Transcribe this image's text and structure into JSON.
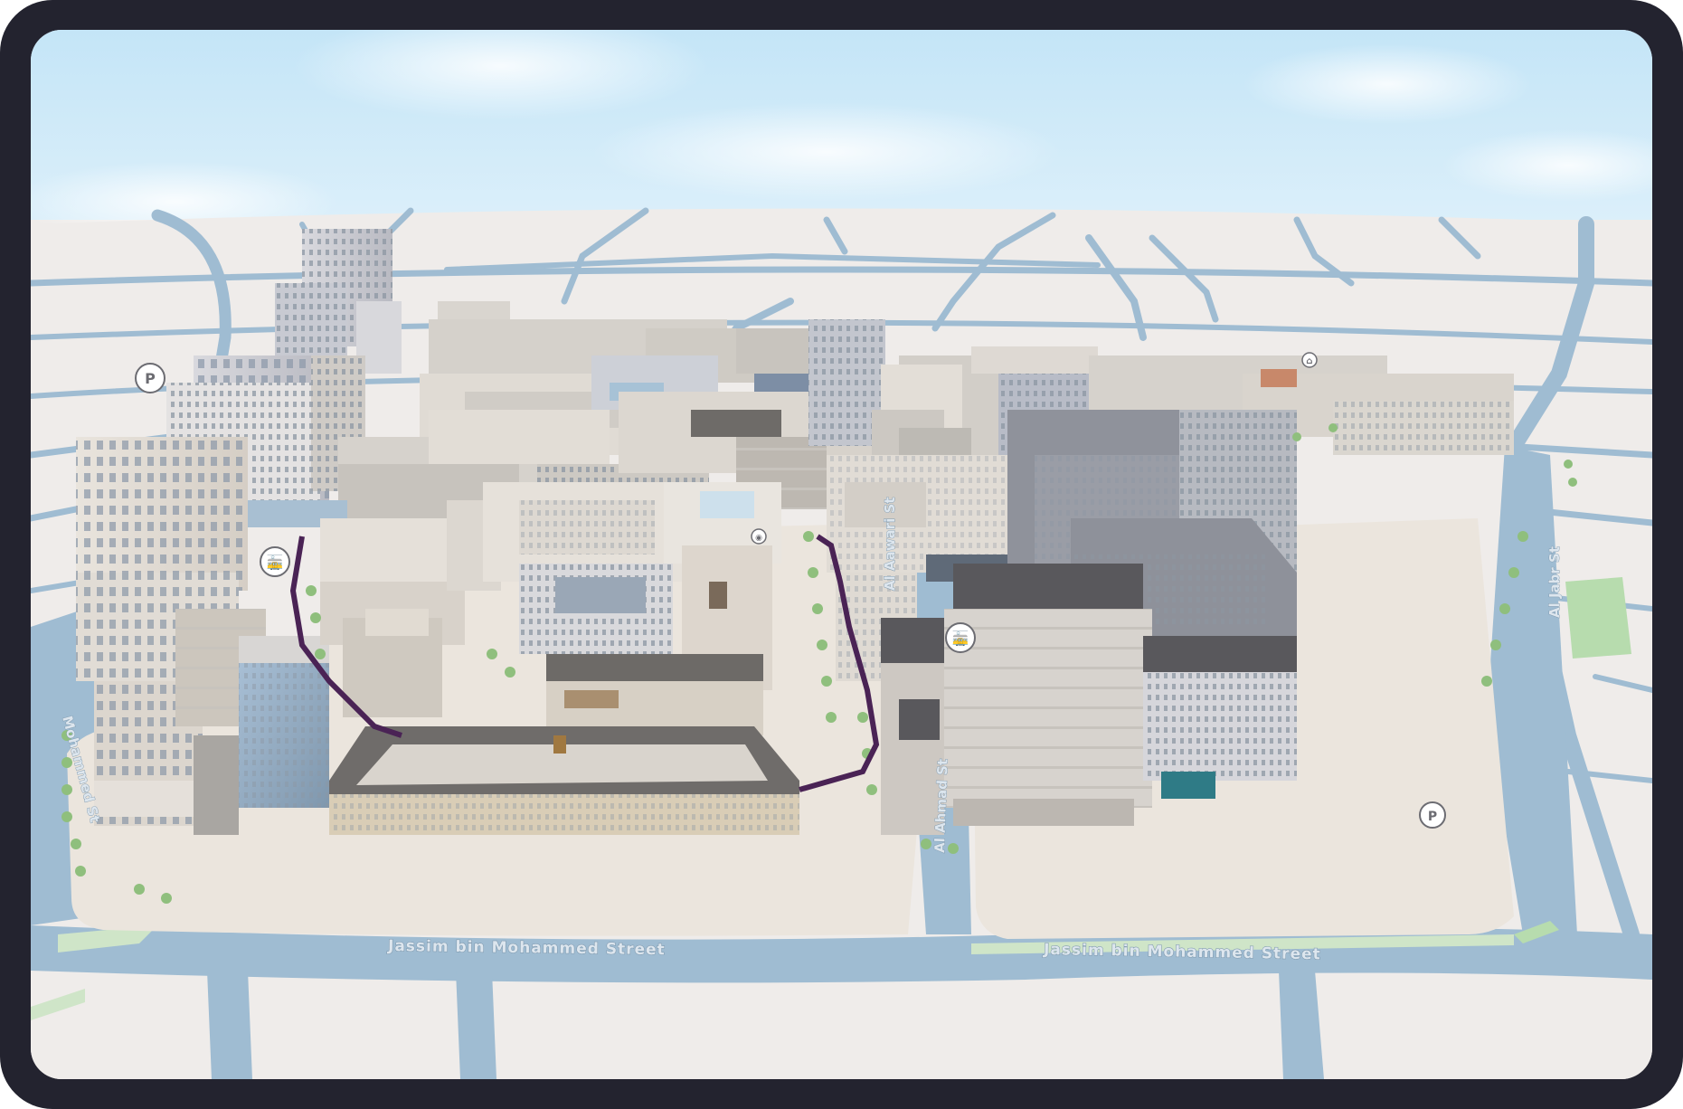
{
  "map": {
    "view": "3D city scene",
    "colors": {
      "frame": "#23232f",
      "sky": "#cfe9f8",
      "ground": "#efecea",
      "water": "#9fbcd2",
      "tram_line": "#4a2355",
      "park": "#b7dcae"
    },
    "street_labels": {
      "south_west": "Jassim bin Mohammed Street",
      "south_east": "Jassim bin Mohammed Street",
      "center_vertical": "Al Ahmad St",
      "west_vertical": "Mohammed St",
      "east_vertical": "Al Jabr St",
      "inner_vertical": "Al Aawari St"
    },
    "poi_icons": [
      {
        "name": "parking-icon",
        "glyph": "P"
      },
      {
        "name": "tram-icon",
        "glyph": "🚋"
      },
      {
        "name": "tram-icon",
        "glyph": "🚋"
      },
      {
        "name": "parking-icon",
        "glyph": "P"
      },
      {
        "name": "museum-icon",
        "glyph": "⌂"
      },
      {
        "name": "entrance-icon",
        "glyph": "◉"
      }
    ]
  }
}
